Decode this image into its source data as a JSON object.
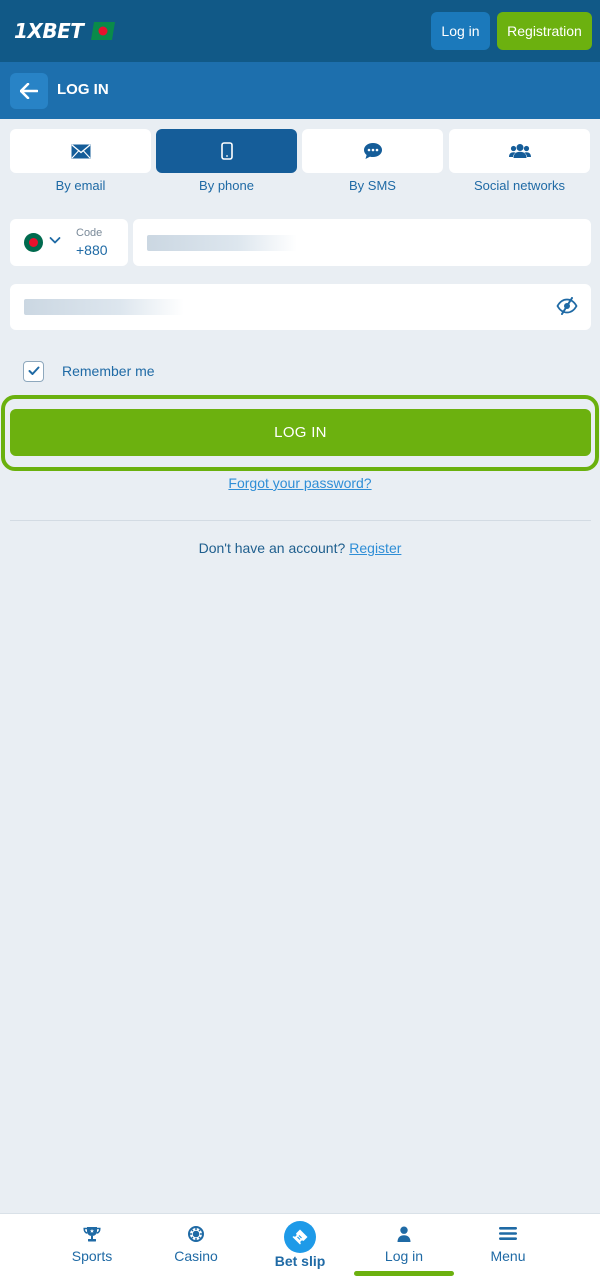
{
  "header": {
    "logo_text": "1XBET",
    "login_label": "Log in",
    "register_label": "Registration"
  },
  "subheader": {
    "title": "LOG IN"
  },
  "tabs": [
    {
      "label": "By email",
      "icon": "envelope-icon",
      "active": false
    },
    {
      "label": "By phone",
      "icon": "phone-icon",
      "active": true
    },
    {
      "label": "By SMS",
      "icon": "chat-icon",
      "active": false
    },
    {
      "label": "Social networks",
      "icon": "users-icon",
      "active": false
    }
  ],
  "phone": {
    "code_label": "Code",
    "code_value": "+880"
  },
  "remember": {
    "label": "Remember me",
    "checked": true
  },
  "login_button": "LOG IN",
  "forgot_link": "Forgot your password?",
  "signup": {
    "text": "Don't have an account?",
    "link": "Register"
  },
  "bottom_nav": [
    {
      "label": "Sports",
      "icon": "trophy-icon"
    },
    {
      "label": "Casino",
      "icon": "casino-chip-icon"
    },
    {
      "label": "Bet slip",
      "icon": "ticket-icon"
    },
    {
      "label": "Log in",
      "icon": "user-icon",
      "active": true
    },
    {
      "label": "Menu",
      "icon": "hamburger-icon"
    }
  ],
  "colors": {
    "brand_dark": "#115987",
    "brand_blue": "#1d6fad",
    "accent_green": "#6cb10f",
    "background": "#e9eef3"
  }
}
